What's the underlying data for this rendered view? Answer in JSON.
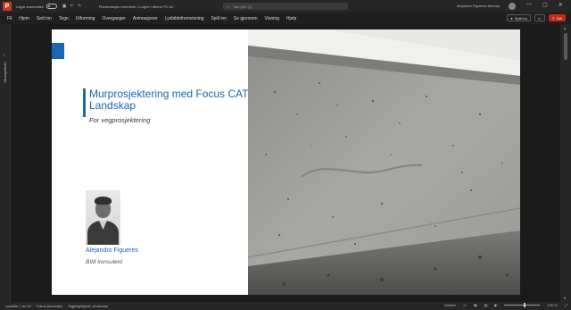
{
  "titlebar": {
    "logo_letter": "P",
    "autosave_label": "Lagre automatisk",
    "document_title": "Presentasjon med bilde • Lagret i denne PC-en",
    "search_placeholder": "Søk (Alt+Q)",
    "user_name": "Alejandro Figueres Moreno",
    "window_controls": [
      "—",
      "▢",
      "✕"
    ]
  },
  "menu": {
    "items": [
      "Fil",
      "Hjem",
      "Sett inn",
      "Tegn",
      "Utforming",
      "Overganger",
      "Animasjoner",
      "Lysbildefremvisning",
      "Spill inn",
      "Se gjennom",
      "Visning",
      "Hjelp"
    ]
  },
  "ribbon": {
    "record_label": "Spill inn",
    "delete_label": "Del"
  },
  "pane": {
    "label": "Miniatyrbilder"
  },
  "slide": {
    "title": "Murprosjektering med Focus CAT Landskap",
    "subtitle": "For vegprosjektering",
    "person_name": "Alejandro Figueres",
    "person_role": "BIM konsulent",
    "accent_color": "#1a66b3"
  },
  "statusbar": {
    "slide_info": "Lysbilde 1 av 10",
    "focus_label": "Fokus (kontrakt)",
    "accessibility": "Tilgjengelighet: Undersøk",
    "notes_label": "Notater",
    "zoom": "125 %"
  }
}
